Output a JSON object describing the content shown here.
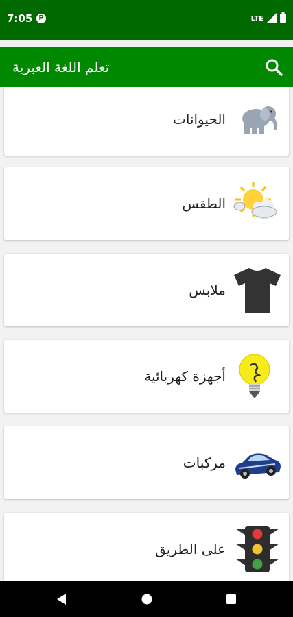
{
  "status_bar": {
    "time": "7:05",
    "network": "LTE",
    "app_icon": "P"
  },
  "app_bar": {
    "title": "تعلم اللغة العبرية",
    "search_icon": "search-icon"
  },
  "categories": [
    {
      "label": "الحيوانات",
      "icon": "elephant-icon"
    },
    {
      "label": "الطقس",
      "icon": "sun-cloud-icon"
    },
    {
      "label": "ملابس",
      "icon": "tshirt-icon"
    },
    {
      "label": "أجهزة كهربائية",
      "icon": "lightbulb-icon"
    },
    {
      "label": "مركبات",
      "icon": "car-icon"
    },
    {
      "label": "على الطريق",
      "icon": "traffic-light-icon"
    }
  ],
  "colors": {
    "status_bar": "#006a00",
    "app_bar": "#008800",
    "background": "#f2f2f2"
  }
}
